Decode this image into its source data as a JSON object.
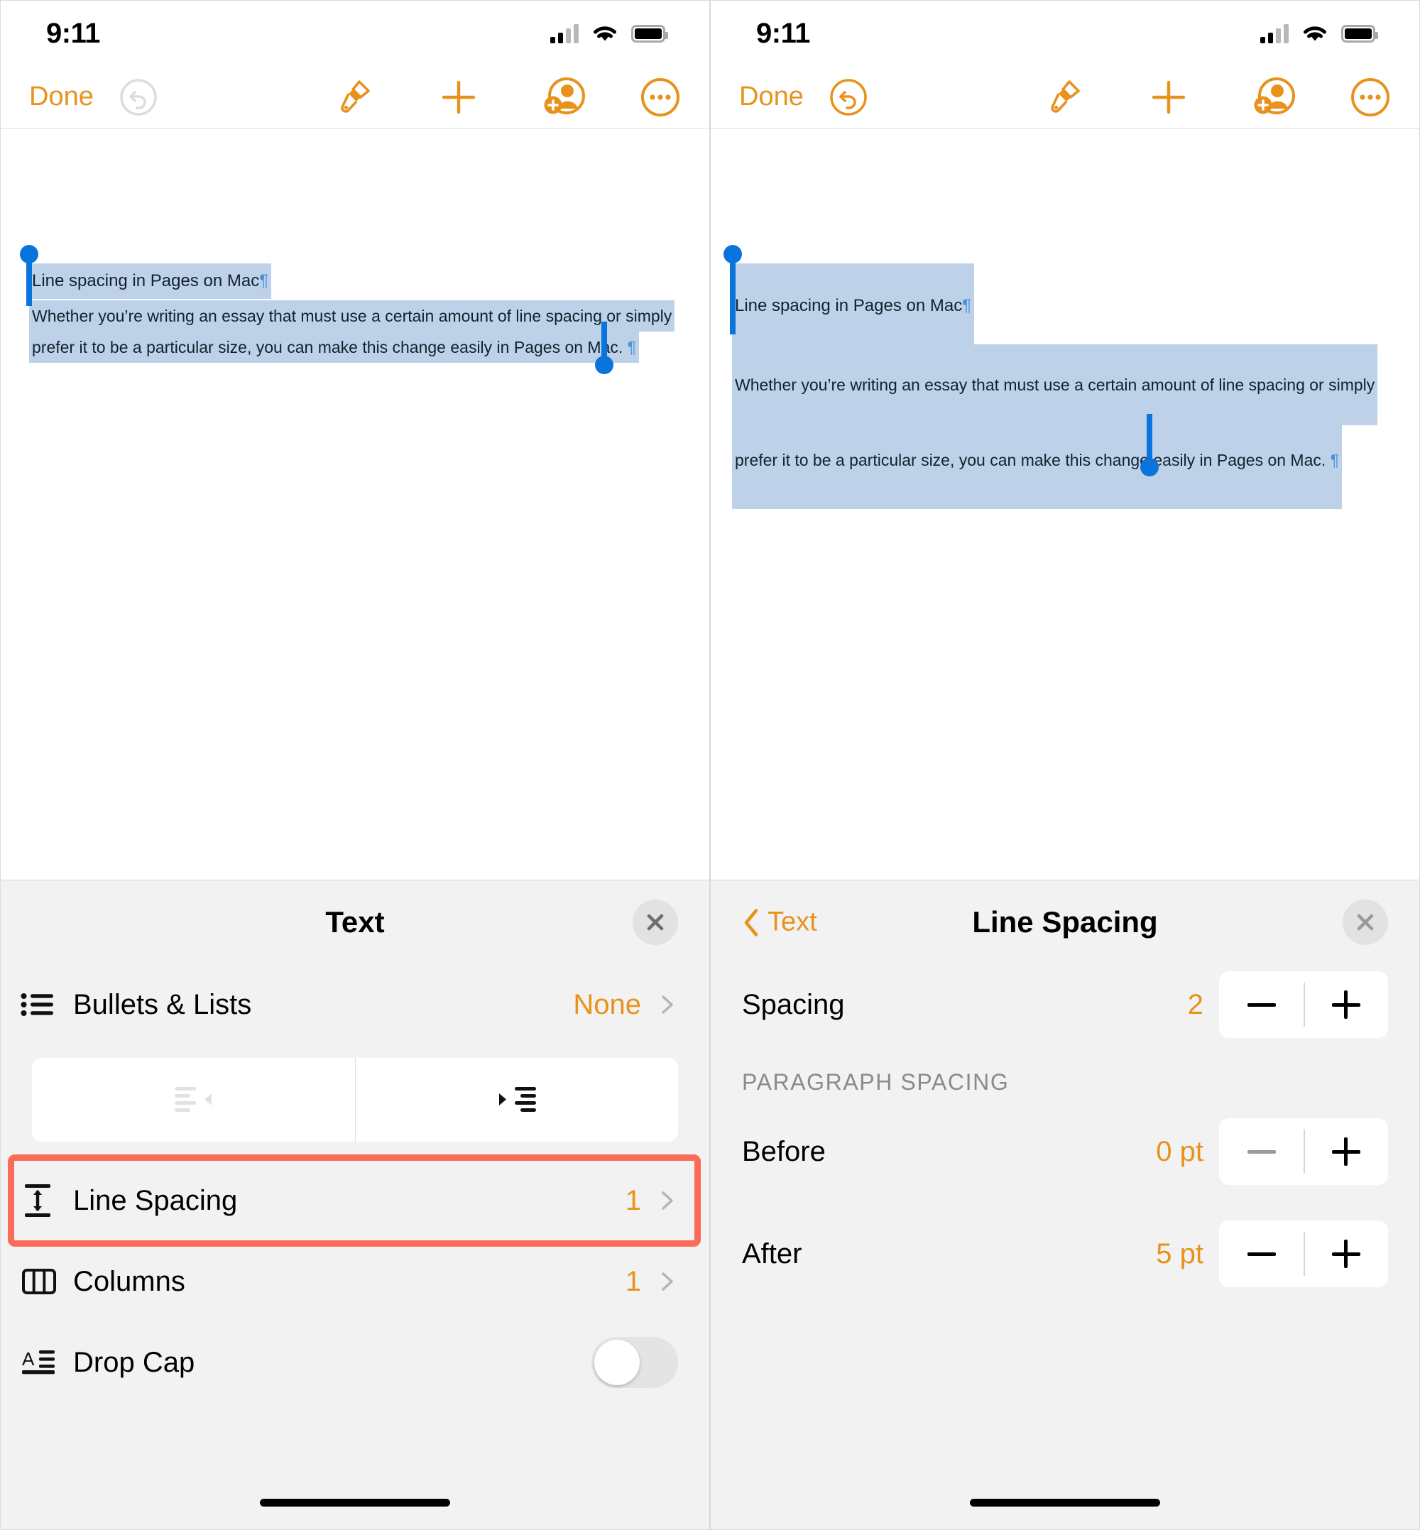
{
  "status_bar": {
    "time": "9:11",
    "cellular_icon": "signal-bars-icon",
    "wifi_icon": "wifi-icon",
    "battery_icon": "battery-icon"
  },
  "toolbar": {
    "done_label": "Done",
    "undo_icon": "undo-icon",
    "format_icon": "paintbrush-icon",
    "insert_icon": "plus-icon",
    "collaborate_icon": "add-person-icon",
    "more_icon": "ellipsis-circle-icon"
  },
  "accent_color": "#E8921B",
  "highlight_color": "#FA6B5A",
  "selection_color": "#bdd2e8",
  "handle_color": "#0a74dd",
  "document": {
    "heading": "Line spacing in Pages on Mac",
    "pilcrow": "¶",
    "body_line_1": "Whether you’re writing an essay that must use a certain amount of line spacing or simply",
    "body_line_2": "prefer it to be a particular size, you can make this change easily in Pages on Mac.",
    "body_full": "Whether you’re writing an essay that must use a certain amount of line spacing or simply prefer it to be a particular size, you can make this change easily in Pages on Mac."
  },
  "left_panel": {
    "title": "Text",
    "close_icon": "close-icon",
    "rows": [
      {
        "icon": "bullets-list-icon",
        "label": "Bullets & Lists",
        "value": "None",
        "chevron": "chevron-right-icon"
      },
      {
        "icon": "line-spacing-icon",
        "label": "Line Spacing",
        "value": "1",
        "chevron": "chevron-right-icon"
      },
      {
        "icon": "columns-icon",
        "label": "Columns",
        "value": "1",
        "chevron": "chevron-right-icon"
      },
      {
        "icon": "drop-cap-icon",
        "label": "Drop Cap",
        "value": "off"
      }
    ],
    "indent": {
      "decrease_icon": "decrease-indent-icon",
      "decrease_enabled": "false",
      "increase_icon": "increase-indent-icon",
      "increase_enabled": "true"
    }
  },
  "right_panel": {
    "back_label": "Text",
    "back_icon": "chevron-left-icon",
    "title": "Line Spacing",
    "close_icon": "close-icon",
    "spacing": {
      "label": "Spacing",
      "value": "2",
      "minus_icon": "minus-icon",
      "plus_icon": "plus-icon",
      "minus_enabled": "true"
    },
    "section_caption": "PARAGRAPH SPACING",
    "before": {
      "label": "Before",
      "value": "0 pt",
      "minus_icon": "minus-icon",
      "plus_icon": "plus-icon",
      "minus_enabled": "false"
    },
    "after": {
      "label": "After",
      "value": "5 pt",
      "minus_icon": "minus-icon",
      "plus_icon": "plus-icon",
      "minus_enabled": "true"
    }
  },
  "home_indicator": "home-indicator"
}
